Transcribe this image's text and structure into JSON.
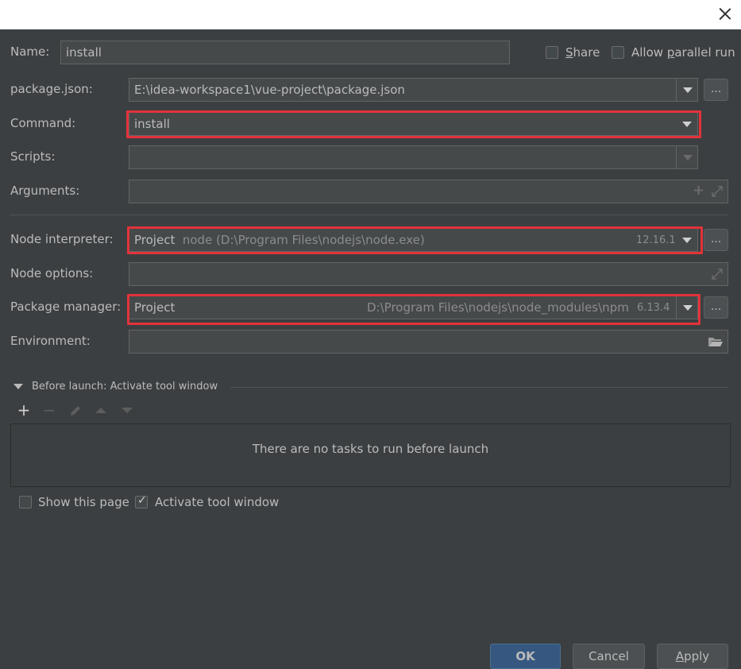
{
  "window": {
    "close_icon": "close-icon"
  },
  "name": {
    "label": "Name:",
    "value": "install"
  },
  "share": {
    "label_before": "",
    "label_u": "S",
    "label_after": "hare",
    "checked": false
  },
  "parallel": {
    "label_before": "Allow ",
    "label_u": "p",
    "label_after": "arallel run",
    "checked": false
  },
  "package_json": {
    "label": "package.json:",
    "value": "E:\\idea-workspace1\\vue-project\\package.json",
    "browse": "..."
  },
  "command": {
    "label": "Command:",
    "value": "install"
  },
  "scripts": {
    "label": "Scripts:",
    "value": ""
  },
  "arguments": {
    "label": "Arguments:",
    "value": ""
  },
  "node_interpreter": {
    "label": "Node interpreter:",
    "value": "Project",
    "path": "node (D:\\Program Files\\nodejs\\node.exe)",
    "version": "12.16.1",
    "browse": "..."
  },
  "node_options": {
    "label": "Node options:",
    "value": ""
  },
  "package_manager": {
    "label": "Package manager:",
    "value": "Project",
    "path": "D:\\Program Files\\nodejs\\node_modules\\npm",
    "version": "6.13.4",
    "browse": "..."
  },
  "environment": {
    "label": "Environment:",
    "value": ""
  },
  "before_launch": {
    "title": "Before launch: Activate tool window",
    "empty_message": "There are no tasks to run before launch"
  },
  "show_page": {
    "label": "Show this page",
    "checked": false
  },
  "activate_tool": {
    "label": "Activate tool window",
    "checked": true
  },
  "buttons": {
    "ok": "OK",
    "cancel": "Cancel",
    "apply_u": "A",
    "apply_rest": "pply"
  },
  "colors": {
    "background": "#3c3f41",
    "highlight_border": "#e2333a",
    "primary_button": "#365880"
  }
}
